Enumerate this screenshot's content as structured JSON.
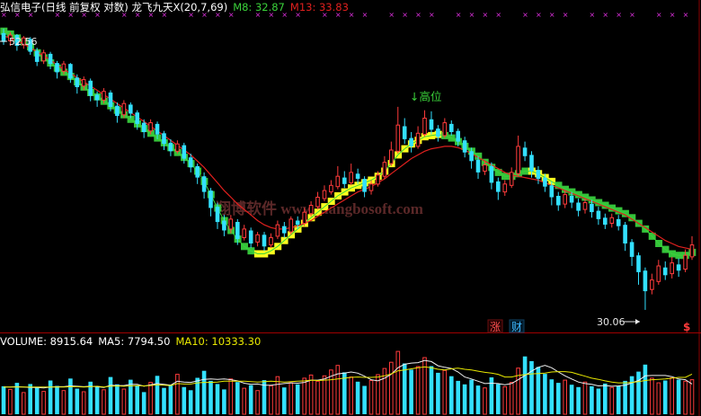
{
  "header": {
    "title": "弘信电子(日线 前复权 对数) 龙飞九天X(20,7,69)",
    "m8_label": "M8: 32.87",
    "m13_label": "M13: 33.83"
  },
  "volume_header": {
    "volume_label": "VOLUME: 8915.64",
    "ma5_label": "MA5: 7794.50",
    "ma10_label": "MA10: 10333.30"
  },
  "annotations": {
    "high_label": "52.56",
    "peak_label": "↓高位",
    "low_label": "30.06",
    "zhang_label": "涨",
    "cai_label": "财",
    "corner_label": "$",
    "watermark": "翔博软件 www.xiangbosoft.com"
  },
  "colors": {
    "up": "#ff3b3b",
    "down": "#33e0ff",
    "ma_red": "#e0201e",
    "ma_green": "#3ad23a",
    "band_green": "#35c33a",
    "band_yellow": "#ffff1e",
    "marker_magenta": "#e030e0",
    "ma5_white": "#f0f0f0",
    "ma10_yellow": "#e8e800"
  },
  "chart_data": {
    "type": "candlestick",
    "scale": "log",
    "price_range": [
      29.0,
      53.5
    ],
    "high_price": 52.56,
    "low_price": 30.06,
    "m8": 32.87,
    "m13": 33.83,
    "candles": [
      [
        52.1,
        51.2,
        52.56,
        50.9
      ],
      [
        51.3,
        51.9,
        52.2,
        50.8
      ],
      [
        51.9,
        50.8,
        52.0,
        50.3
      ],
      [
        50.9,
        51.6,
        51.8,
        50.5
      ],
      [
        51.5,
        50.2,
        51.7,
        49.9
      ],
      [
        50.3,
        49.2,
        50.6,
        48.8
      ],
      [
        49.3,
        50.1,
        50.4,
        49.0
      ],
      [
        50.0,
        49.0,
        50.2,
        48.5
      ],
      [
        49.1,
        48.2,
        49.3,
        47.6
      ],
      [
        48.3,
        49.0,
        49.3,
        48.0
      ],
      [
        49.0,
        47.6,
        49.1,
        47.2
      ],
      [
        47.7,
        46.8,
        48.0,
        46.2
      ],
      [
        46.9,
        47.5,
        47.8,
        46.5
      ],
      [
        47.4,
        46.0,
        47.6,
        45.5
      ],
      [
        46.1,
        45.6,
        46.4,
        45.0
      ],
      [
        45.6,
        46.4,
        46.7,
        45.3
      ],
      [
        46.3,
        45.0,
        46.5,
        44.6
      ],
      [
        45.1,
        44.2,
        45.4,
        43.6
      ],
      [
        44.3,
        45.3,
        45.6,
        44.0
      ],
      [
        45.2,
        44.4,
        45.4,
        44.0
      ],
      [
        44.5,
        43.5,
        44.7,
        43.0
      ],
      [
        43.6,
        42.8,
        43.9,
        42.3
      ],
      [
        42.9,
        43.6,
        43.9,
        42.6
      ],
      [
        43.5,
        42.6,
        43.7,
        42.2
      ],
      [
        42.7,
        41.8,
        42.9,
        41.3
      ],
      [
        41.9,
        41.2,
        42.2,
        40.8
      ],
      [
        41.2,
        41.8,
        42.1,
        41.0
      ],
      [
        41.7,
        40.6,
        41.9,
        40.2
      ],
      [
        40.7,
        39.9,
        41.0,
        39.5
      ],
      [
        40.0,
        39.1,
        40.2,
        38.6
      ],
      [
        39.2,
        38.0,
        39.5,
        37.5
      ],
      [
        38.1,
        36.8,
        38.3,
        36.2
      ],
      [
        36.9,
        35.8,
        37.2,
        35.3
      ],
      [
        35.9,
        35.2,
        36.3,
        34.8
      ],
      [
        35.3,
        36.0,
        36.3,
        35.0
      ],
      [
        35.8,
        34.6,
        36.0,
        34.2
      ],
      [
        34.7,
        35.3,
        35.6,
        34.5
      ],
      [
        35.2,
        34.3,
        35.4,
        34.0
      ],
      [
        34.4,
        34.9,
        35.1,
        34.1
      ],
      [
        34.9,
        34.1,
        35.1,
        33.8
      ],
      [
        34.2,
        34.7,
        35.0,
        34.0
      ],
      [
        34.8,
        35.6,
        35.9,
        34.6
      ],
      [
        35.5,
        35.0,
        35.8,
        34.7
      ],
      [
        35.1,
        36.0,
        36.2,
        34.9
      ],
      [
        35.9,
        35.6,
        36.2,
        35.3
      ],
      [
        35.7,
        36.5,
        36.8,
        35.5
      ],
      [
        36.4,
        37.0,
        37.3,
        36.2
      ],
      [
        36.9,
        37.6,
        38.0,
        36.7
      ],
      [
        37.5,
        38.1,
        38.5,
        37.3
      ],
      [
        38.0,
        38.5,
        38.9,
        37.8
      ],
      [
        38.4,
        39.2,
        40.0,
        38.2
      ],
      [
        39.1,
        38.6,
        39.6,
        38.3
      ],
      [
        38.7,
        39.5,
        40.2,
        38.5
      ],
      [
        39.4,
        39.0,
        39.8,
        38.6
      ],
      [
        39.0,
        38.0,
        39.2,
        37.6
      ],
      [
        38.1,
        38.6,
        38.9,
        37.8
      ],
      [
        38.6,
        39.3,
        39.6,
        38.4
      ],
      [
        39.2,
        40.3,
        40.8,
        39.0
      ],
      [
        40.2,
        41.3,
        42.0,
        40.0
      ],
      [
        41.2,
        43.4,
        45.0,
        41.0
      ],
      [
        43.3,
        42.2,
        44.0,
        41.8
      ],
      [
        42.3,
        41.6,
        42.8,
        41.1
      ],
      [
        41.6,
        42.7,
        43.3,
        41.4
      ],
      [
        42.6,
        44.0,
        44.7,
        42.4
      ],
      [
        43.9,
        43.0,
        44.6,
        42.6
      ],
      [
        43.1,
        42.4,
        43.4,
        42.0
      ],
      [
        42.5,
        43.6,
        44.0,
        42.3
      ],
      [
        43.5,
        42.8,
        43.8,
        42.5
      ],
      [
        42.9,
        42.0,
        43.1,
        41.6
      ],
      [
        42.1,
        41.1,
        42.4,
        40.7
      ],
      [
        41.2,
        40.4,
        41.5,
        39.8
      ],
      [
        40.5,
        39.5,
        40.8,
        39.0
      ],
      [
        39.6,
        40.1,
        40.4,
        39.3
      ],
      [
        40.0,
        38.7,
        40.3,
        38.2
      ],
      [
        38.8,
        38.0,
        39.1,
        37.4
      ],
      [
        38.0,
        38.6,
        38.9,
        37.7
      ],
      [
        38.5,
        39.5,
        39.9,
        38.3
      ],
      [
        39.4,
        41.6,
        42.5,
        39.2
      ],
      [
        41.5,
        40.8,
        42.0,
        40.4
      ],
      [
        40.9,
        39.6,
        41.2,
        39.1
      ],
      [
        39.7,
        39.0,
        40.0,
        38.6
      ],
      [
        39.1,
        38.4,
        39.4,
        38.0
      ],
      [
        38.5,
        37.6,
        38.8,
        37.0
      ],
      [
        37.7,
        37.0,
        38.0,
        36.6
      ],
      [
        37.1,
        37.8,
        38.1,
        36.8
      ],
      [
        37.7,
        37.2,
        38.0,
        36.8
      ],
      [
        37.2,
        36.6,
        37.5,
        36.2
      ],
      [
        36.7,
        37.2,
        37.5,
        36.4
      ],
      [
        37.1,
        36.5,
        37.4,
        36.1
      ],
      [
        36.6,
        36.0,
        36.9,
        35.6
      ],
      [
        36.1,
        35.6,
        36.4,
        35.3
      ],
      [
        35.7,
        36.1,
        36.4,
        35.4
      ],
      [
        36.0,
        35.5,
        36.3,
        35.2
      ],
      [
        35.6,
        34.3,
        35.8,
        33.8
      ],
      [
        34.4,
        33.4,
        34.6,
        32.8
      ],
      [
        33.5,
        32.4,
        33.7,
        31.6
      ],
      [
        32.5,
        31.2,
        32.7,
        30.06
      ],
      [
        31.3,
        31.9,
        32.3,
        31.0
      ],
      [
        31.8,
        32.8,
        33.2,
        31.6
      ],
      [
        32.7,
        32.2,
        33.1,
        31.9
      ],
      [
        32.3,
        33.0,
        33.4,
        32.0
      ],
      [
        32.9,
        32.5,
        33.3,
        32.1
      ],
      [
        32.6,
        33.5,
        33.9,
        32.4
      ],
      [
        33.4,
        34.2,
        34.8,
        33.2
      ]
    ],
    "ma_red": [
      51.8,
      51.6,
      51.3,
      51.0,
      50.6,
      50.2,
      49.8,
      49.4,
      48.9,
      48.5,
      48.1,
      47.7,
      47.3,
      46.9,
      46.5,
      46.1,
      45.7,
      45.3,
      44.9,
      44.5,
      44.1,
      43.7,
      43.3,
      42.9,
      42.5,
      42.1,
      41.7,
      41.3,
      40.9,
      40.4,
      39.9,
      39.3,
      38.7,
      38.1,
      37.6,
      37.1,
      36.7,
      36.3,
      35.9,
      35.6,
      35.4,
      35.3,
      35.3,
      35.4,
      35.5,
      35.7,
      35.9,
      36.2,
      36.5,
      36.8,
      37.1,
      37.4,
      37.7,
      38.0,
      38.2,
      38.4,
      38.7,
      39.0,
      39.4,
      39.8,
      40.2,
      40.6,
      40.9,
      41.2,
      41.4,
      41.5,
      41.6,
      41.6,
      41.5,
      41.3,
      41.0,
      40.7,
      40.4,
      40.1,
      39.8,
      39.5,
      39.3,
      39.2,
      39.1,
      39.0,
      38.9,
      38.7,
      38.5,
      38.3,
      38.1,
      37.9,
      37.7,
      37.5,
      37.3,
      37.1,
      36.9,
      36.7,
      36.5,
      36.3,
      36.0,
      35.7,
      35.4,
      35.1,
      34.8,
      34.5,
      34.3,
      34.1,
      34.0,
      33.9
    ],
    "band_line": [
      52.3,
      52.0,
      51.6,
      51.2,
      50.7,
      50.1,
      49.6,
      49.1,
      48.6,
      48.2,
      47.8,
      47.3,
      46.8,
      46.3,
      45.9,
      45.5,
      45.1,
      44.7,
      44.3,
      43.9,
      43.5,
      43.1,
      42.7,
      42.3,
      41.9,
      41.5,
      41.1,
      40.7,
      40.2,
      39.6,
      38.8,
      37.8,
      36.8,
      35.9,
      35.2,
      34.6,
      34.1,
      33.8,
      33.6,
      33.6,
      33.8,
      34.1,
      34.5,
      34.9,
      35.3,
      35.7,
      36.1,
      36.5,
      36.9,
      37.3,
      37.7,
      38.0,
      38.3,
      38.5,
      38.7,
      38.9,
      39.2,
      39.6,
      40.2,
      40.9,
      41.4,
      41.8,
      42.1,
      42.4,
      42.5,
      42.6,
      42.5,
      42.3,
      42.0,
      41.6,
      41.2,
      40.8,
      40.3,
      39.9,
      39.5,
      39.2,
      39.2,
      39.4,
      39.6,
      39.6,
      39.4,
      39.1,
      38.8,
      38.5,
      38.2,
      38.0,
      37.8,
      37.6,
      37.4,
      37.2,
      37.0,
      36.8,
      36.6,
      36.4,
      36.1,
      35.7,
      35.3,
      34.8,
      34.3,
      33.9,
      33.6,
      33.5,
      33.5,
      33.7
    ],
    "band_colors": "GGGGGGGGGGGGGGGGGGGGGGGGGGGGGGGGGGGGGGYYYYYYYYYYYYYYYYYYYYYYYYYYYYGGGGGGGGGGGGGYYYYGGGGGGGGGGGGGGGGGGGGGGGGY",
    "volume_range": [
      0,
      16000
    ],
    "volume": [
      7200,
      6400,
      8100,
      5600,
      7800,
      6900,
      5900,
      8700,
      7300,
      6100,
      9200,
      6600,
      5800,
      8400,
      7100,
      6300,
      9600,
      7700,
      6500,
      8900,
      7400,
      5700,
      8200,
      9900,
      6800,
      7600,
      10300,
      7000,
      6200,
      9400,
      11200,
      8600,
      7800,
      6400,
      9100,
      8300,
      6700,
      7500,
      6100,
      8800,
      7300,
      9700,
      6900,
      8100,
      7700,
      9300,
      10100,
      8500,
      9900,
      11400,
      12600,
      10800,
      9600,
      8400,
      7300,
      8700,
      10200,
      11800,
      13400,
      16200,
      13100,
      11500,
      12300,
      14600,
      12400,
      10700,
      11300,
      9800,
      8600,
      7700,
      8900,
      7400,
      6800,
      9500,
      7800,
      7100,
      8200,
      11900,
      14900,
      13700,
      12200,
      10400,
      9000,
      8100,
      8800,
      7600,
      7000,
      8300,
      7200,
      6600,
      7900,
      6900,
      7300,
      8600,
      9800,
      11000,
      12800,
      9300,
      8100,
      8700,
      9400,
      8900,
      8500,
      8915.64
    ],
    "ma5": [
      7000,
      7000,
      7100,
      7000,
      6900,
      6900,
      6800,
      7000,
      7100,
      7100,
      7300,
      7200,
      7100,
      7200,
      7100,
      6900,
      7500,
      7400,
      7400,
      7700,
      7700,
      7200,
      7600,
      7900,
      7700,
      7500,
      8500,
      8300,
      8200,
      8600,
      9000,
      9100,
      9000,
      9100,
      8900,
      8600,
      8000,
      7700,
      7800,
      7500,
      7500,
      7700,
      7900,
      8100,
      8000,
      8200,
      8800,
      8800,
      9100,
      9800,
      10400,
      10600,
      10900,
      10600,
      9800,
      8900,
      8600,
      9300,
      10300,
      12000,
      12900,
      13200,
      13300,
      13900,
      13600,
      12500,
      12100,
      11800,
      10900,
      9600,
      9100,
      8500,
      7900,
      8000,
      7900,
      7600,
      7900,
      8900,
      10000,
      11100,
      12100,
      12600,
      12000,
      10900,
      9900,
      9100,
      8300,
      7900,
      7700,
      7300,
      7400,
      7200,
      7300,
      7500,
      8100,
      8700,
      9900,
      10000,
      10000,
      10000,
      9700,
      9100,
      8900,
      7794.5
    ],
    "ma10": [
      7000,
      7000,
      7000,
      7000,
      7000,
      7000,
      7000,
      7000,
      7000,
      7000,
      7100,
      7100,
      7000,
      7100,
      7200,
      7000,
      7200,
      7300,
      7200,
      7300,
      7400,
      7300,
      7400,
      7600,
      7500,
      7400,
      7900,
      7800,
      7800,
      8100,
      8200,
      8200,
      8300,
      8500,
      8500,
      8500,
      8500,
      8400,
      8300,
      8400,
      8500,
      8400,
      8300,
      8400,
      8500,
      8600,
      8800,
      8700,
      8800,
      8900,
      9100,
      9300,
      9500,
      9600,
      9500,
      9500,
      9600,
      9900,
      10400,
      11200,
      11400,
      11700,
      12000,
      12200,
      12000,
      11600,
      11400,
      11700,
      11900,
      11600,
      11400,
      11100,
      10800,
      10600,
      10300,
      9600,
      9600,
      10000,
      10200,
      10400,
      10500,
      10600,
      10900,
      11000,
      11000,
      10800,
      10300,
      9800,
      9300,
      9000,
      8600,
      8300,
      8100,
      8100,
      8200,
      8400,
      8700,
      8900,
      9000,
      9100,
      9300,
      9500,
      9500,
      10333.3
    ]
  }
}
